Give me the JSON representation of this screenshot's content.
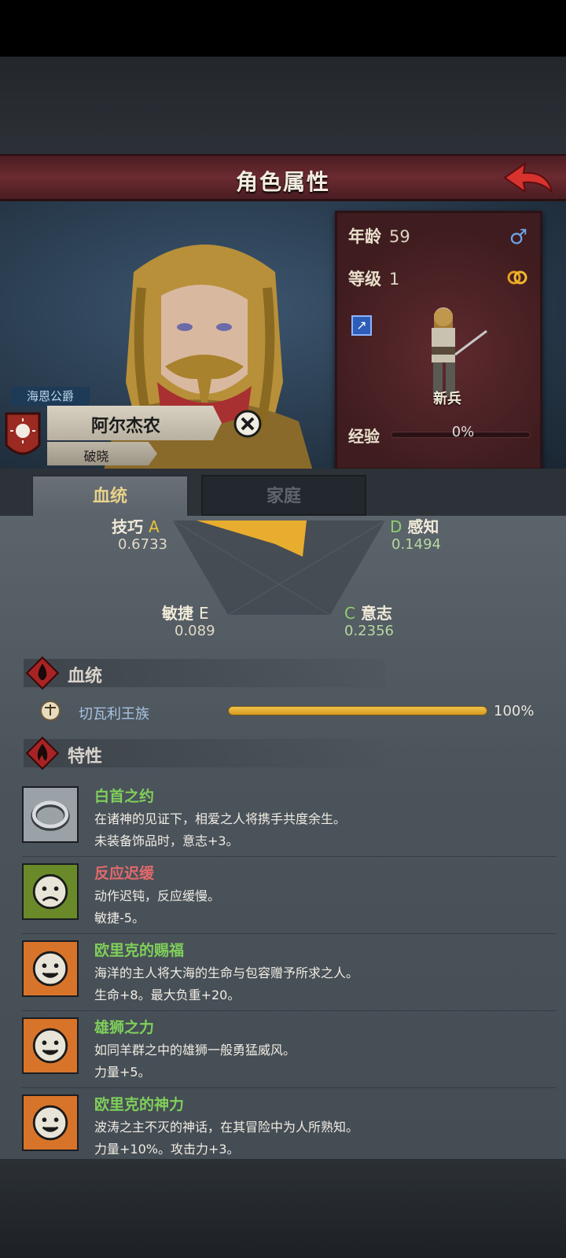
{
  "header": {
    "title": "角色属性"
  },
  "character": {
    "house": "海恩公爵",
    "name": "阿尔杰农",
    "title": "破晓"
  },
  "stats": {
    "age_label": "年龄",
    "age": "59",
    "level_label": "等级",
    "level": "1",
    "class_name": "新兵",
    "exp_label": "经验",
    "exp_pct": "0%",
    "exp_fraction": 0.0
  },
  "tabs": {
    "active": "血统",
    "inactive": "家庭"
  },
  "attributes": {
    "skill": {
      "label": "技巧",
      "grade": "A",
      "value": "0.6733"
    },
    "perception": {
      "label": "感知",
      "grade": "D",
      "value": "0.1494"
    },
    "agility": {
      "label": "敏捷",
      "grade": "E",
      "value": "0.089"
    },
    "will": {
      "label": "意志",
      "grade": "C",
      "value": "0.2356"
    }
  },
  "bloodline_section": {
    "title": "血统",
    "entries": [
      {
        "name": "切瓦利王族",
        "percent": "100%",
        "fraction": 1.0
      }
    ]
  },
  "traits_section": {
    "title": "特性",
    "items": [
      {
        "name": "白首之约",
        "type": "good",
        "desc": "在诸神的见证下，相爱之人将携手共度余生。",
        "effect": "未装备饰品时，意志+3。"
      },
      {
        "name": "反应迟缓",
        "type": "bad",
        "desc": "动作迟钝，反应缓慢。",
        "effect": "敏捷-5。"
      },
      {
        "name": "欧里克的赐福",
        "type": "good",
        "desc": "海洋的主人将大海的生命与包容赠予所求之人。",
        "effect": "生命+8。最大负重+20。"
      },
      {
        "name": "雄狮之力",
        "type": "good",
        "desc": "如同羊群之中的雄狮一般勇猛威风。",
        "effect": "力量+5。"
      },
      {
        "name": "欧里克的神力",
        "type": "good",
        "desc": "波涛之主不灭的神话，在其冒险中为人所熟知。",
        "effect": "力量+10%。攻击力+3。"
      }
    ]
  },
  "colors": {
    "header": "#6b2a30",
    "good_trait": "#7fcf5a",
    "bad_trait": "#e06a6a",
    "skill_grade": "#e8c23a",
    "perception_grade": "#8fd06a",
    "agility_grade": "#d8d8d8",
    "will_grade": "#8fd06a"
  },
  "icons": {
    "back": "back-arrow-icon",
    "gender": "male-icon",
    "marriage": "ring-icon",
    "weapon": "dagger-icon",
    "remove": "close-icon",
    "bloodline": "blood-drop-icon",
    "traits": "flame-icon"
  }
}
